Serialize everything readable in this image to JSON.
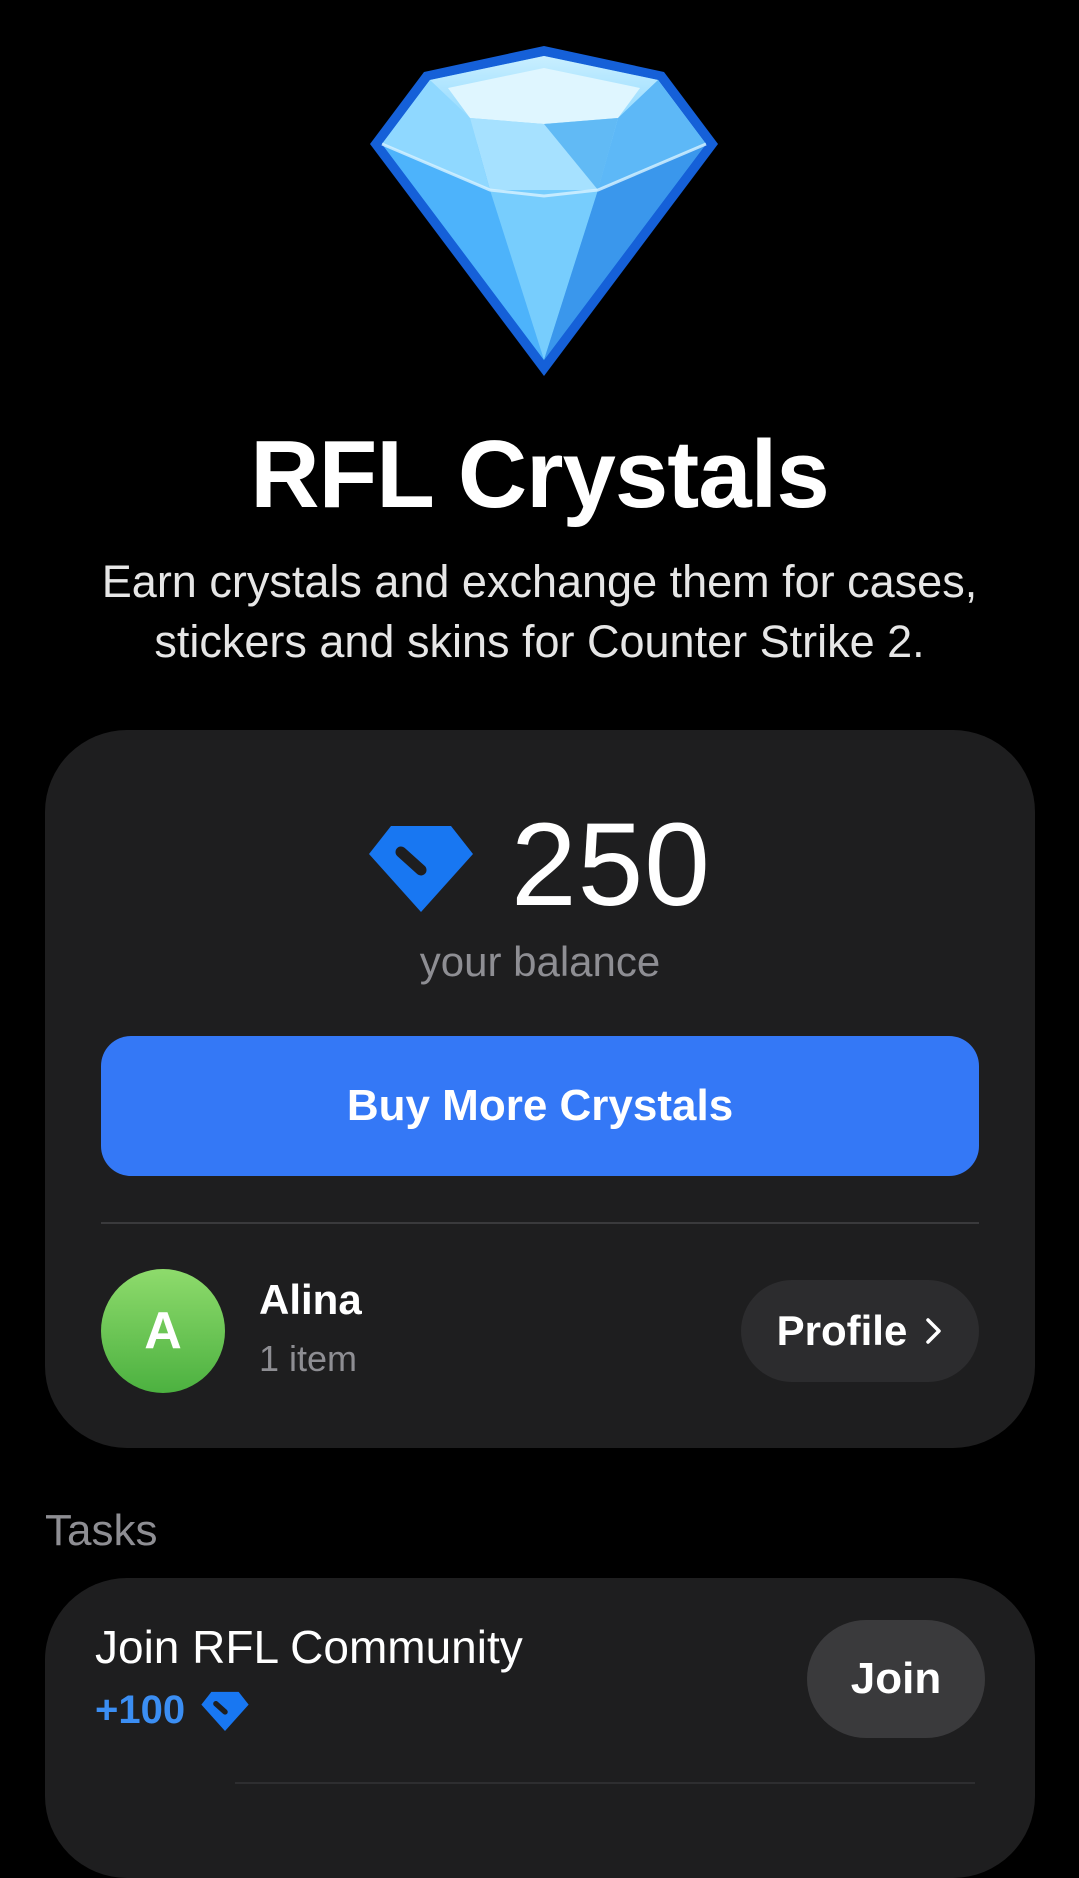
{
  "hero": {
    "icon": "diamond-icon",
    "title": "RFL Crystals",
    "subtitle_line1": "Earn crystals and exchange them for cases,",
    "subtitle_line2": "stickers and skins for Counter Strike 2."
  },
  "balance": {
    "icon": "crystal-icon",
    "value": "250",
    "caption": "your balance",
    "buy_label": "Buy More Crystals"
  },
  "user": {
    "avatar_letter": "A",
    "name": "Alina",
    "items": "1 item",
    "profile_label": "Profile"
  },
  "tasks": {
    "header": "Tasks",
    "items": [
      {
        "title": "Join RFL Community",
        "reward": "+100",
        "button_label": "Join"
      }
    ]
  },
  "colors": {
    "accent": "#3478f6",
    "reward_blue": "#3b8ef3",
    "card_bg": "#1e1e1f",
    "avatar_green": "#5cc24a"
  }
}
